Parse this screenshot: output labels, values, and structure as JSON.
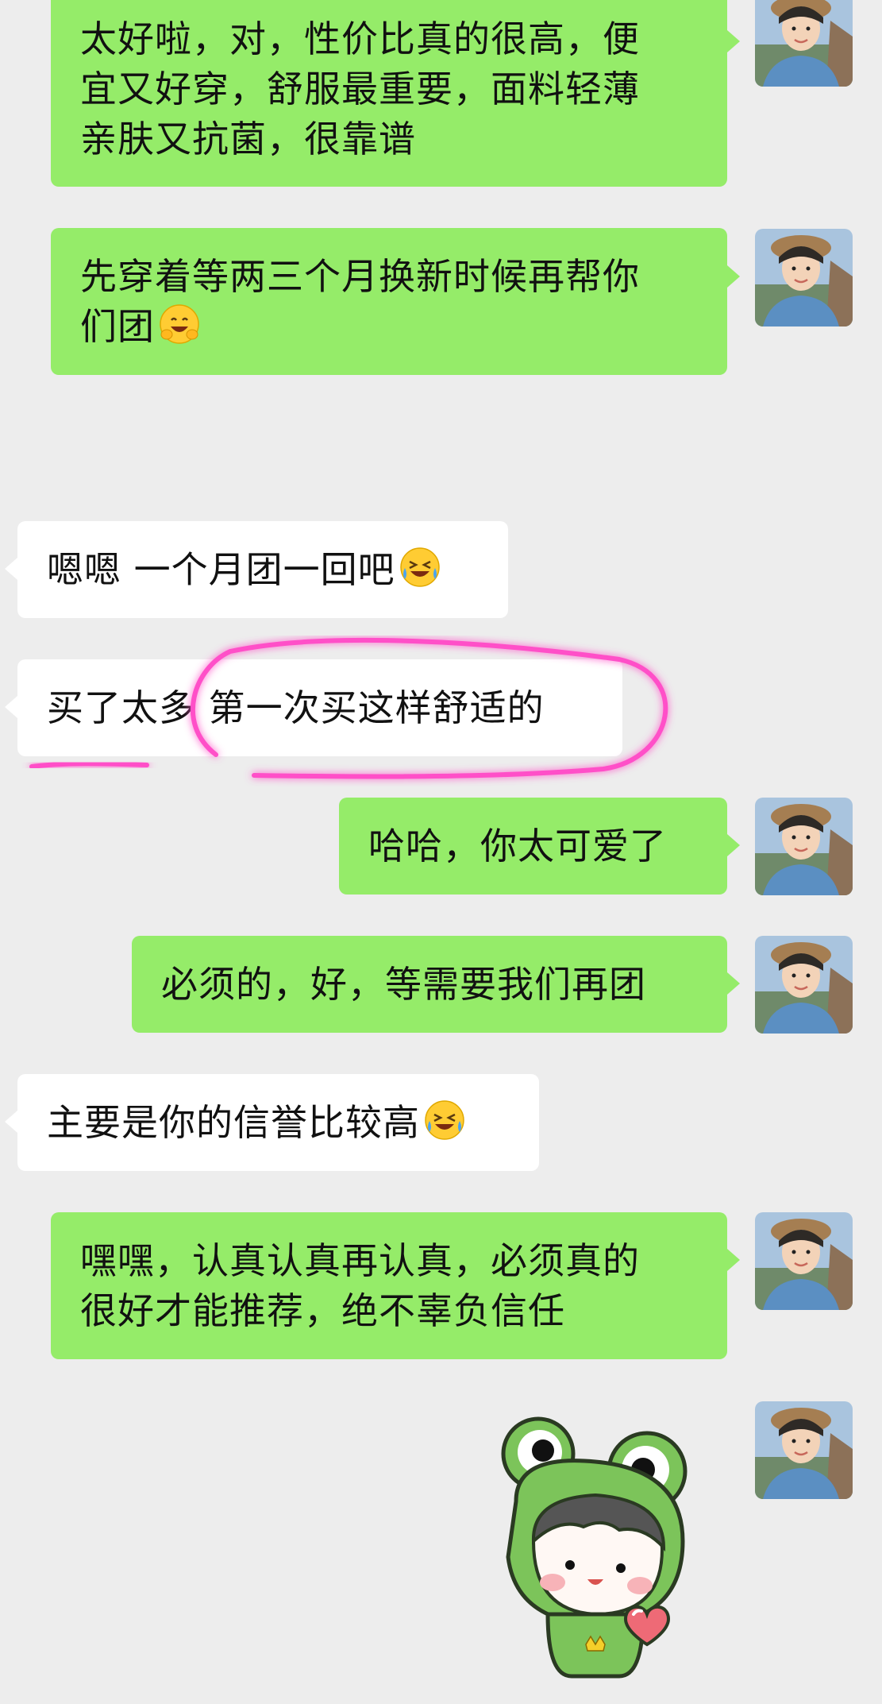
{
  "conversation": {
    "messages": [
      {
        "sender": "me",
        "lines": [
          "太好啦，对，性价比真的很高，便",
          "宜又好穿，舒服最重要，面料轻薄",
          "亲肤又抗菌，很靠谱"
        ]
      },
      {
        "sender": "me",
        "lines": [
          "先穿着等两三个月换新时候再帮你",
          "们团"
        ],
        "emoji": "hugging-face"
      },
      {
        "sender": "them",
        "lines": [
          "嗯嗯 一个月团一回吧"
        ],
        "emoji": "rolling-laughing-face"
      },
      {
        "sender": "them",
        "lines": [
          "买了太多 第一次买这样舒适的"
        ],
        "annotation": "pink-circle-highlight"
      },
      {
        "sender": "me",
        "lines": [
          "哈哈，你太可爱了"
        ]
      },
      {
        "sender": "me",
        "lines": [
          "必须的，好，等需要我们再团"
        ]
      },
      {
        "sender": "them",
        "lines": [
          "主要是你的信誉比较高"
        ],
        "emoji": "rolling-laughing-face"
      },
      {
        "sender": "me",
        "lines": [
          "嘿嘿，认真认真再认真，必须真的",
          "很好才能推荐，绝不辜负信任"
        ]
      },
      {
        "sender": "me",
        "sticker": "frog-costume-kid-holding-heart"
      }
    ]
  },
  "colors": {
    "background": "#ededed",
    "my_bubble": "#95ec69",
    "their_bubble": "#ffffff",
    "highlight": "#ff4fc8"
  }
}
